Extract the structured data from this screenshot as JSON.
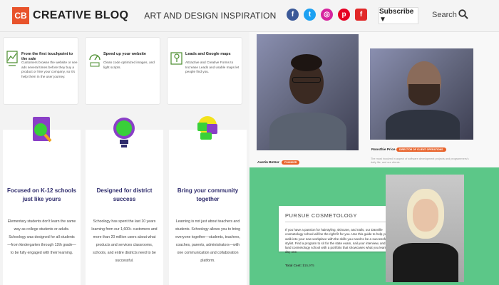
{
  "header": {
    "logo_mark": "CB",
    "logo_text": "CREATIVE BLOQ",
    "tagline": "ART AND DESIGN INSPIRATION",
    "subscribe_label": "Subscribe ▼",
    "search_label": "Search",
    "social_icons": [
      {
        "name": "facebook-icon",
        "glyph": "f",
        "color": "#3b5998"
      },
      {
        "name": "twitter-icon",
        "glyph": "t",
        "color": "#1da1f2"
      },
      {
        "name": "instagram-icon",
        "glyph": "◎",
        "color": "#d6249f"
      },
      {
        "name": "pinterest-icon",
        "glyph": "p",
        "color": "#e60023"
      },
      {
        "name": "flipboard-icon",
        "glyph": "f",
        "color": "#e12828"
      }
    ]
  },
  "features": [
    {
      "title": "From the first touchpoint to the sale",
      "body": "Customers browse the website or see ads several times before they buy a product or hire your company, so it's help them in the user journey."
    },
    {
      "title": "Speed up your website",
      "body": "Clean code optimized images, and light scripts."
    },
    {
      "title": "Leads and Google maps",
      "body": "Attractive and Creative Forms to Increase Leads and usable maps let people find you."
    }
  ],
  "cards": [
    {
      "title": "Focused on K-12 schools just like yours",
      "body": "Elementary students don't learn the same way as college students or adults. Schoology was designed for all students—from kindergarten through 12th grade—to be fully engaged with their learning."
    },
    {
      "title": "Designed for district success",
      "body": "Schoology has spent the last 10 years learning from our 1,600+ customers and more than 20 million users about what products and services classrooms, schools, and entire districts need to be successful."
    },
    {
      "title": "Bring your community together",
      "body": "Learning is not just about teachers and students. Schoology allows you to bring everyone together—students, teachers, coaches, parents, administrators—with one communication and collaboration platform."
    }
  ],
  "profiles": [
    {
      "name": "Austin Betzer",
      "tag": "FOUNDER"
    },
    {
      "name": "Roosthie Price",
      "tag": "DIRECTOR OF CLIENT OPERATIONS",
      "desc": "The most involved in aspect of software development projects and programmers's daily life, and our clients."
    }
  ],
  "promo": {
    "title": "PURSUE COSMETOLOGY",
    "body": "If you have a passion for hairstyling, skincare, and nails, our Danville cosmetology school will be the right fit for you. Use this guide to help you walk into your new workplace with the skills you need to be a successful stylist. Find a program to sit for the state exam, nail your interview, and land cosmetology school with a portfolio that showcases what you learn day one.",
    "cost_label": "Total Cost:",
    "cost_value": "$15,975"
  }
}
